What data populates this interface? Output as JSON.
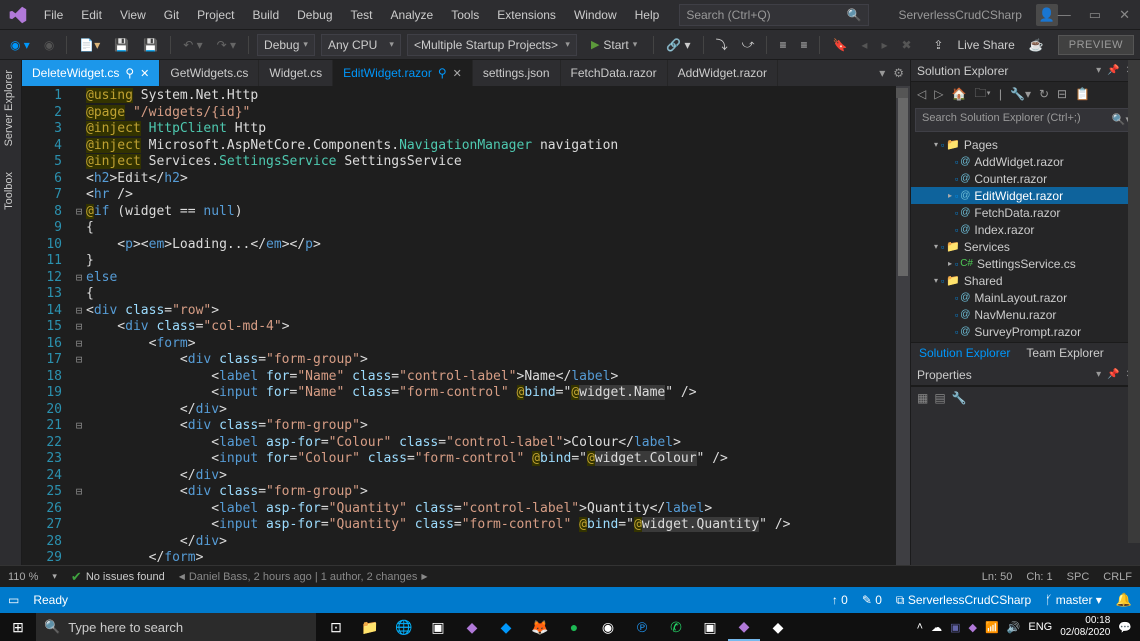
{
  "menu": [
    "File",
    "Edit",
    "View",
    "Git",
    "Project",
    "Build",
    "Debug",
    "Test",
    "Analyze",
    "Tools",
    "Extensions",
    "Window",
    "Help"
  ],
  "search": {
    "placeholder": "Search (Ctrl+Q)"
  },
  "solution_label": "ServerlessCrudCSharp",
  "toolbar": {
    "config": "Debug",
    "platform": "Any CPU",
    "startup": "<Multiple Startup Projects>",
    "start": "Start",
    "liveshare": "Live Share",
    "preview": "PREVIEW"
  },
  "tabs": [
    {
      "label": "DeleteWidget.cs",
      "state": "active",
      "pinned": true
    },
    {
      "label": "GetWidgets.cs",
      "state": "normal"
    },
    {
      "label": "Widget.cs",
      "state": "normal"
    },
    {
      "label": "EditWidget.razor",
      "state": "selected",
      "pinned": true
    },
    {
      "label": "settings.json",
      "state": "normal"
    },
    {
      "label": "FetchData.razor",
      "state": "normal"
    },
    {
      "label": "AddWidget.razor",
      "state": "normal"
    }
  ],
  "side_tabs": [
    "Server Explorer",
    "Toolbox"
  ],
  "code": {
    "lines": [
      {
        "n": 1,
        "parts": [
          {
            "c": "dir",
            "t": "@using"
          },
          {
            "c": "txt",
            "t": " "
          },
          {
            "c": "ident",
            "t": "System.Net.Http"
          }
        ]
      },
      {
        "n": 2,
        "parts": [
          {
            "c": "dir",
            "t": "@page"
          },
          {
            "c": "txt",
            "t": " "
          },
          {
            "c": "str",
            "t": "\"/widgets/{id}\""
          }
        ]
      },
      {
        "n": 3,
        "parts": [
          {
            "c": "dir",
            "t": "@inject"
          },
          {
            "c": "txt",
            "t": " "
          },
          {
            "c": "type",
            "t": "HttpClient"
          },
          {
            "c": "txt",
            "t": " "
          },
          {
            "c": "ident",
            "t": "Http"
          }
        ]
      },
      {
        "n": 4,
        "parts": [
          {
            "c": "dir",
            "t": "@inject"
          },
          {
            "c": "txt",
            "t": " "
          },
          {
            "c": "ident",
            "t": "Microsoft.AspNetCore.Components."
          },
          {
            "c": "type",
            "t": "NavigationManager"
          },
          {
            "c": "txt",
            "t": " "
          },
          {
            "c": "ident",
            "t": "navigation"
          }
        ]
      },
      {
        "n": 5,
        "parts": [
          {
            "c": "dir",
            "t": "@inject"
          },
          {
            "c": "txt",
            "t": " "
          },
          {
            "c": "ident",
            "t": "Services."
          },
          {
            "c": "type",
            "t": "SettingsService"
          },
          {
            "c": "txt",
            "t": " "
          },
          {
            "c": "ident",
            "t": "SettingsService"
          }
        ]
      },
      {
        "n": 6,
        "parts": [
          {
            "c": "txt",
            "t": "<"
          },
          {
            "c": "tag",
            "t": "h2"
          },
          {
            "c": "txt",
            "t": ">Edit</"
          },
          {
            "c": "tag",
            "t": "h2"
          },
          {
            "c": "txt",
            "t": ">"
          }
        ]
      },
      {
        "n": 7,
        "parts": [
          {
            "c": "txt",
            "t": "<"
          },
          {
            "c": "tag",
            "t": "hr"
          },
          {
            "c": "txt",
            "t": " />"
          }
        ]
      },
      {
        "n": 8,
        "fold": "⊟",
        "parts": [
          {
            "c": "dir",
            "t": "@"
          },
          {
            "c": "kw",
            "t": "if"
          },
          {
            "c": "txt",
            "t": " (widget == "
          },
          {
            "c": "null",
            "t": "null"
          },
          {
            "c": "txt",
            "t": ")"
          }
        ]
      },
      {
        "n": 9,
        "parts": [
          {
            "c": "txt",
            "t": "{"
          }
        ]
      },
      {
        "n": 10,
        "parts": [
          {
            "c": "txt",
            "t": "    <"
          },
          {
            "c": "tag",
            "t": "p"
          },
          {
            "c": "txt",
            "t": "><"
          },
          {
            "c": "tag",
            "t": "em"
          },
          {
            "c": "txt",
            "t": ">Loading...</"
          },
          {
            "c": "tag",
            "t": "em"
          },
          {
            "c": "txt",
            "t": "></"
          },
          {
            "c": "tag",
            "t": "p"
          },
          {
            "c": "txt",
            "t": ">"
          }
        ]
      },
      {
        "n": 11,
        "parts": [
          {
            "c": "txt",
            "t": "}"
          }
        ]
      },
      {
        "n": 12,
        "fold": "⊟",
        "parts": [
          {
            "c": "kw",
            "t": "else"
          }
        ]
      },
      {
        "n": 13,
        "parts": [
          {
            "c": "txt",
            "t": "{"
          }
        ]
      },
      {
        "n": 14,
        "fold": "⊟",
        "parts": [
          {
            "c": "txt",
            "t": "<"
          },
          {
            "c": "tag",
            "t": "div"
          },
          {
            "c": "txt",
            "t": " "
          },
          {
            "c": "attr",
            "t": "class"
          },
          {
            "c": "txt",
            "t": "="
          },
          {
            "c": "str",
            "t": "\"row\""
          },
          {
            "c": "txt",
            "t": ">"
          }
        ]
      },
      {
        "n": 15,
        "fold": "⊟",
        "parts": [
          {
            "c": "txt",
            "t": "    <"
          },
          {
            "c": "tag",
            "t": "div"
          },
          {
            "c": "txt",
            "t": " "
          },
          {
            "c": "attr",
            "t": "class"
          },
          {
            "c": "txt",
            "t": "="
          },
          {
            "c": "str",
            "t": "\"col-md-4\""
          },
          {
            "c": "txt",
            "t": ">"
          }
        ]
      },
      {
        "n": 16,
        "fold": "⊟",
        "parts": [
          {
            "c": "txt",
            "t": "        <"
          },
          {
            "c": "tag",
            "t": "form"
          },
          {
            "c": "txt",
            "t": ">"
          }
        ]
      },
      {
        "n": 17,
        "fold": "⊟",
        "parts": [
          {
            "c": "txt",
            "t": "            <"
          },
          {
            "c": "tag",
            "t": "div"
          },
          {
            "c": "txt",
            "t": " "
          },
          {
            "c": "attr",
            "t": "class"
          },
          {
            "c": "txt",
            "t": "="
          },
          {
            "c": "str",
            "t": "\"form-group\""
          },
          {
            "c": "txt",
            "t": ">"
          }
        ]
      },
      {
        "n": 18,
        "parts": [
          {
            "c": "txt",
            "t": "                <"
          },
          {
            "c": "tag",
            "t": "label"
          },
          {
            "c": "txt",
            "t": " "
          },
          {
            "c": "attr",
            "t": "for"
          },
          {
            "c": "txt",
            "t": "="
          },
          {
            "c": "str",
            "t": "\"Name\""
          },
          {
            "c": "txt",
            "t": " "
          },
          {
            "c": "attr",
            "t": "class"
          },
          {
            "c": "txt",
            "t": "="
          },
          {
            "c": "str",
            "t": "\"control-label\""
          },
          {
            "c": "txt",
            "t": ">Name</"
          },
          {
            "c": "tag",
            "t": "label"
          },
          {
            "c": "txt",
            "t": ">"
          }
        ]
      },
      {
        "n": 19,
        "parts": [
          {
            "c": "txt",
            "t": "                <"
          },
          {
            "c": "tag",
            "t": "input"
          },
          {
            "c": "txt",
            "t": " "
          },
          {
            "c": "attr",
            "t": "for"
          },
          {
            "c": "txt",
            "t": "="
          },
          {
            "c": "str",
            "t": "\"Name\""
          },
          {
            "c": "txt",
            "t": " "
          },
          {
            "c": "attr",
            "t": "class"
          },
          {
            "c": "txt",
            "t": "="
          },
          {
            "c": "str",
            "t": "\"form-control\""
          },
          {
            "c": "txt",
            "t": " "
          },
          {
            "c": "razor",
            "t": "@"
          },
          {
            "c": "attr",
            "t": "bind"
          },
          {
            "c": "txt",
            "t": "=\""
          },
          {
            "c": "razor",
            "t": "@"
          },
          {
            "c": "ident hlbg",
            "t": "widget.Name"
          },
          {
            "c": "txt",
            "t": "\" />"
          }
        ]
      },
      {
        "n": 20,
        "parts": [
          {
            "c": "txt",
            "t": "            </"
          },
          {
            "c": "tag",
            "t": "div"
          },
          {
            "c": "txt",
            "t": ">"
          }
        ]
      },
      {
        "n": 21,
        "fold": "⊟",
        "parts": [
          {
            "c": "txt",
            "t": "            <"
          },
          {
            "c": "tag",
            "t": "div"
          },
          {
            "c": "txt",
            "t": " "
          },
          {
            "c": "attr",
            "t": "class"
          },
          {
            "c": "txt",
            "t": "="
          },
          {
            "c": "str",
            "t": "\"form-group\""
          },
          {
            "c": "txt",
            "t": ">"
          }
        ]
      },
      {
        "n": 22,
        "parts": [
          {
            "c": "txt",
            "t": "                <"
          },
          {
            "c": "tag",
            "t": "label"
          },
          {
            "c": "txt",
            "t": " "
          },
          {
            "c": "attr",
            "t": "asp-for"
          },
          {
            "c": "txt",
            "t": "="
          },
          {
            "c": "str",
            "t": "\"Colour\""
          },
          {
            "c": "txt",
            "t": " "
          },
          {
            "c": "attr",
            "t": "class"
          },
          {
            "c": "txt",
            "t": "="
          },
          {
            "c": "str",
            "t": "\"control-label\""
          },
          {
            "c": "txt",
            "t": ">Colour</"
          },
          {
            "c": "tag",
            "t": "label"
          },
          {
            "c": "txt",
            "t": ">"
          }
        ]
      },
      {
        "n": 23,
        "parts": [
          {
            "c": "txt",
            "t": "                <"
          },
          {
            "c": "tag",
            "t": "input"
          },
          {
            "c": "txt",
            "t": " "
          },
          {
            "c": "attr",
            "t": "for"
          },
          {
            "c": "txt",
            "t": "="
          },
          {
            "c": "str",
            "t": "\"Colour\""
          },
          {
            "c": "txt",
            "t": " "
          },
          {
            "c": "attr",
            "t": "class"
          },
          {
            "c": "txt",
            "t": "="
          },
          {
            "c": "str",
            "t": "\"form-control\""
          },
          {
            "c": "txt",
            "t": " "
          },
          {
            "c": "razor",
            "t": "@"
          },
          {
            "c": "attr",
            "t": "bind"
          },
          {
            "c": "txt",
            "t": "=\""
          },
          {
            "c": "razor",
            "t": "@"
          },
          {
            "c": "ident hlbg",
            "t": "widget.Colour"
          },
          {
            "c": "txt",
            "t": "\" />"
          }
        ]
      },
      {
        "n": 24,
        "parts": [
          {
            "c": "txt",
            "t": "            </"
          },
          {
            "c": "tag",
            "t": "div"
          },
          {
            "c": "txt",
            "t": ">"
          }
        ]
      },
      {
        "n": 25,
        "fold": "⊟",
        "parts": [
          {
            "c": "txt",
            "t": "            <"
          },
          {
            "c": "tag",
            "t": "div"
          },
          {
            "c": "txt",
            "t": " "
          },
          {
            "c": "attr",
            "t": "class"
          },
          {
            "c": "txt",
            "t": "="
          },
          {
            "c": "str",
            "t": "\"form-group\""
          },
          {
            "c": "txt",
            "t": ">"
          }
        ]
      },
      {
        "n": 26,
        "parts": [
          {
            "c": "txt",
            "t": "                <"
          },
          {
            "c": "tag",
            "t": "label"
          },
          {
            "c": "txt",
            "t": " "
          },
          {
            "c": "attr",
            "t": "asp-for"
          },
          {
            "c": "txt",
            "t": "="
          },
          {
            "c": "str",
            "t": "\"Quantity\""
          },
          {
            "c": "txt",
            "t": " "
          },
          {
            "c": "attr",
            "t": "class"
          },
          {
            "c": "txt",
            "t": "="
          },
          {
            "c": "str",
            "t": "\"control-label\""
          },
          {
            "c": "txt",
            "t": ">Quantity</"
          },
          {
            "c": "tag",
            "t": "label"
          },
          {
            "c": "txt",
            "t": ">"
          }
        ]
      },
      {
        "n": 27,
        "parts": [
          {
            "c": "txt",
            "t": "                <"
          },
          {
            "c": "tag",
            "t": "input"
          },
          {
            "c": "txt",
            "t": " "
          },
          {
            "c": "attr",
            "t": "asp-for"
          },
          {
            "c": "txt",
            "t": "="
          },
          {
            "c": "str",
            "t": "\"Quantity\""
          },
          {
            "c": "txt",
            "t": " "
          },
          {
            "c": "attr",
            "t": "class"
          },
          {
            "c": "txt",
            "t": "="
          },
          {
            "c": "str",
            "t": "\"form-control\""
          },
          {
            "c": "txt",
            "t": " "
          },
          {
            "c": "razor",
            "t": "@"
          },
          {
            "c": "attr",
            "t": "bind"
          },
          {
            "c": "txt",
            "t": "=\""
          },
          {
            "c": "razor",
            "t": "@"
          },
          {
            "c": "ident hlbg",
            "t": "widget.Quantity"
          },
          {
            "c": "txt",
            "t": "\" />"
          }
        ]
      },
      {
        "n": 28,
        "parts": [
          {
            "c": "txt",
            "t": "            </"
          },
          {
            "c": "tag",
            "t": "div"
          },
          {
            "c": "txt",
            "t": ">"
          }
        ]
      },
      {
        "n": 29,
        "parts": [
          {
            "c": "txt",
            "t": "        </"
          },
          {
            "c": "tag",
            "t": "form"
          },
          {
            "c": "txt",
            "t": ">"
          }
        ]
      }
    ]
  },
  "editor_status": {
    "zoom": "110 %",
    "no_issues": "No issues found",
    "git_info": "Daniel Bass, 2 hours ago | 1 author, 2 changes",
    "ln": "Ln: 50",
    "ch": "Ch: 1",
    "spc": "SPC",
    "crlf": "CRLF"
  },
  "solution_explorer": {
    "title": "Solution Explorer",
    "search_placeholder": "Search Solution Explorer (Ctrl+;)",
    "tree": [
      {
        "indent": 1,
        "arrow": "▾",
        "icon": "folder",
        "label": "Pages"
      },
      {
        "indent": 2,
        "arrow": "",
        "icon": "file",
        "label": "AddWidget.razor"
      },
      {
        "indent": 2,
        "arrow": "",
        "icon": "file",
        "label": "Counter.razor"
      },
      {
        "indent": 2,
        "arrow": "▸",
        "icon": "file",
        "label": "EditWidget.razor",
        "selected": true
      },
      {
        "indent": 2,
        "arrow": "",
        "icon": "file",
        "label": "FetchData.razor"
      },
      {
        "indent": 2,
        "arrow": "",
        "icon": "file",
        "label": "Index.razor"
      },
      {
        "indent": 1,
        "arrow": "▾",
        "icon": "folder",
        "label": "Services"
      },
      {
        "indent": 2,
        "arrow": "▸",
        "icon": "cs",
        "label": "SettingsService.cs"
      },
      {
        "indent": 1,
        "arrow": "▾",
        "icon": "folder",
        "label": "Shared"
      },
      {
        "indent": 2,
        "arrow": "",
        "icon": "file",
        "label": "MainLayout.razor"
      },
      {
        "indent": 2,
        "arrow": "",
        "icon": "file",
        "label": "NavMenu.razor"
      },
      {
        "indent": 2,
        "arrow": "",
        "icon": "file",
        "label": "SurveyPrompt.razor"
      }
    ],
    "panel_tabs": [
      "Solution Explorer",
      "Team Explorer"
    ]
  },
  "properties": {
    "title": "Properties"
  },
  "main_status": {
    "ready": "Ready",
    "up": "0",
    "pencil": "0",
    "repo": "ServerlessCrudCSharp",
    "branch": "master"
  },
  "taskbar": {
    "search_placeholder": "Type here to search",
    "lang": "ENG",
    "time": "00:18",
    "date": "02/08/2020"
  }
}
